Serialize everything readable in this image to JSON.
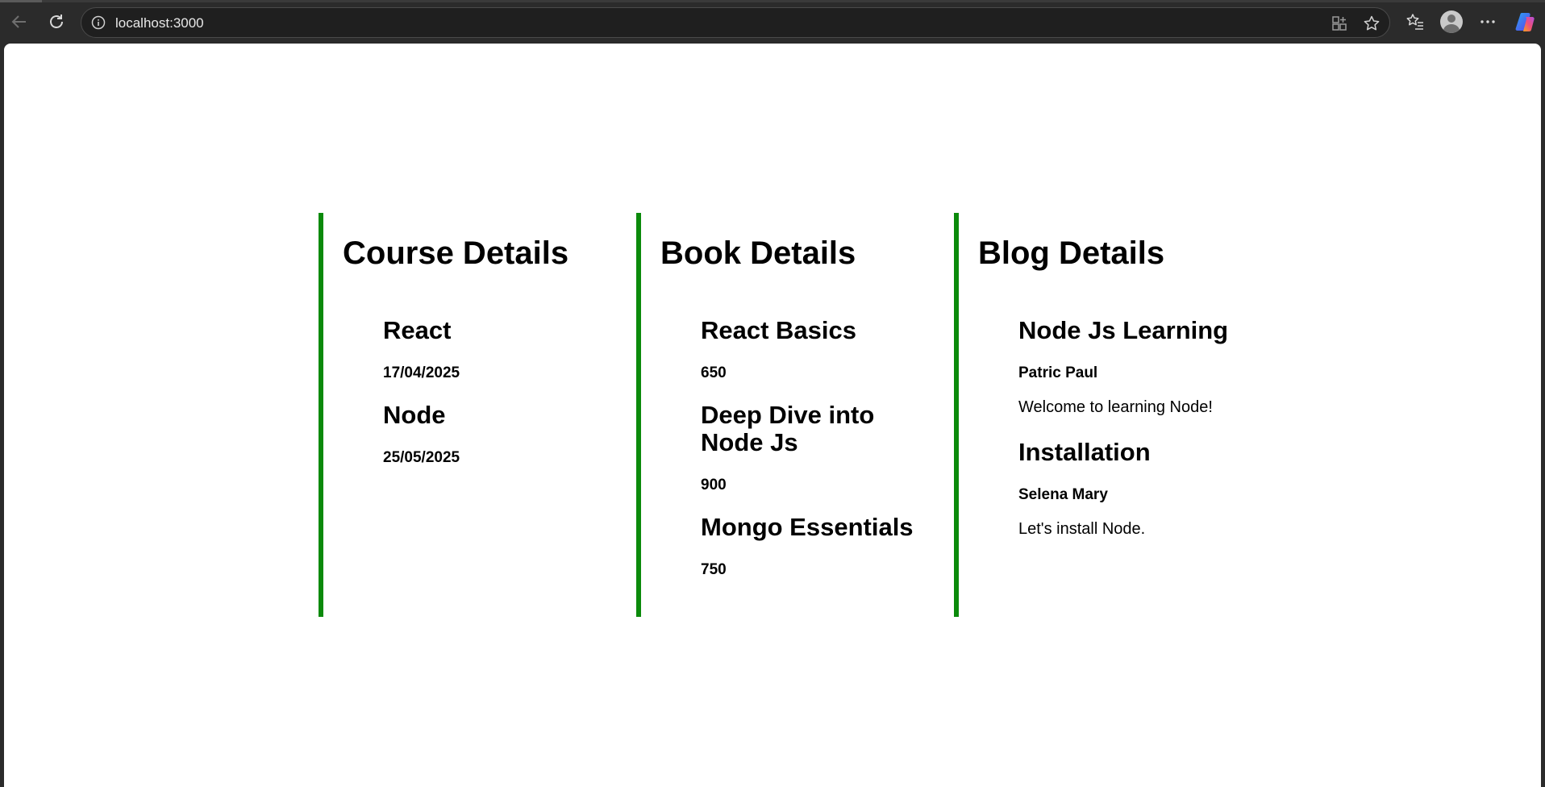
{
  "browser": {
    "url": "localhost:3000"
  },
  "page": {
    "course": {
      "heading": "Course Details",
      "items": [
        {
          "title": "React",
          "date": "17/04/2025"
        },
        {
          "title": "Node",
          "date": "25/05/2025"
        }
      ]
    },
    "book": {
      "heading": "Book Details",
      "items": [
        {
          "title": "React Basics",
          "price": "650"
        },
        {
          "title": "Deep Dive into Node Js",
          "price": "900"
        },
        {
          "title": "Mongo Essentials",
          "price": "750"
        }
      ]
    },
    "blog": {
      "heading": "Blog Details",
      "items": [
        {
          "title": "Node Js Learning",
          "author": "Patric Paul",
          "content": "Welcome to learning Node!"
        },
        {
          "title": "Installation",
          "author": "Selena Mary",
          "content": "Let's install Node."
        }
      ]
    }
  },
  "colors": {
    "accent_border": "#0b8a0b",
    "chrome_bg": "#2b2b2b"
  },
  "icons": [
    "back-icon",
    "reload-icon",
    "info-icon",
    "app-grid-icon",
    "star-icon",
    "favorites-icon",
    "profile-icon",
    "more-icon",
    "copilot-icon"
  ]
}
